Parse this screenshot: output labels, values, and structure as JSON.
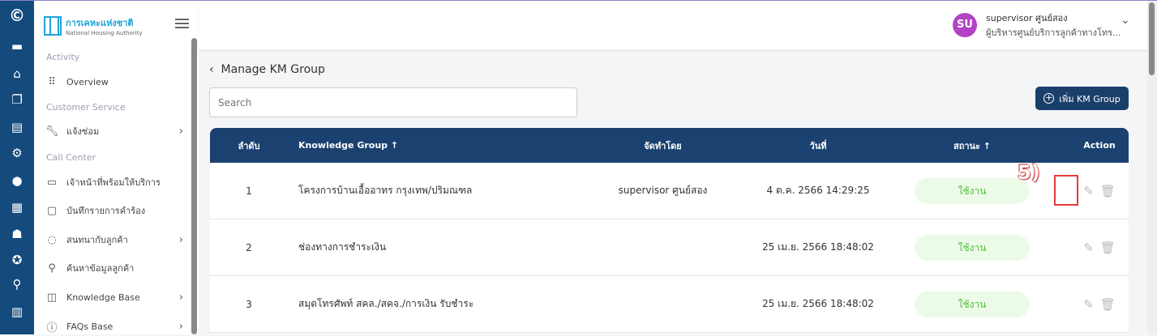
{
  "sidebar": {
    "logo_th": "การเคหะแห่งชาติ",
    "logo_en": "National Housing Authority",
    "sections": [
      "Activity",
      "Customer Service",
      "Call Center"
    ],
    "items": [
      {
        "label": "Overview"
      },
      {
        "label": "แจ้งซ่อม"
      },
      {
        "label": "เจ้าหน้าที่พร้อมให้บริการ"
      },
      {
        "label": "บันทึกรายการคำร้อง"
      },
      {
        "label": "สนทนากับลูกค้า"
      },
      {
        "label": "ค้นหาข้อมูลลูกค้า"
      },
      {
        "label": "Knowledge Base"
      },
      {
        "label": "FAQs Base"
      }
    ]
  },
  "header": {
    "avatar": "SU",
    "user_name": "supervisor ศูนย์สอง",
    "user_role": "ผู้บริหารศูนย์บริการลูกค้าทางโทร..."
  },
  "page": {
    "title": "Manage KM Group",
    "search_placeholder": "Search",
    "add_button": "เพิ่ม KM Group",
    "annotation": "5)"
  },
  "table": {
    "headers": [
      "ลำดับ",
      "Knowledge Group ↑",
      "จัดทำโดย",
      "วันที่",
      "สถานะ ↑",
      "Action"
    ],
    "rows": [
      {
        "no": "1",
        "group": "โครงการบ้านเอื้ออาทร กรุงเทพ/ปริมณฑล",
        "by": "supervisor ศูนย์สอง",
        "date": "4 ต.ค. 2566 14:29:25",
        "status": "ใช้งาน"
      },
      {
        "no": "2",
        "group": "ช่องทางการชำระเงิน",
        "by": "",
        "date": "25 เม.ย. 2566 18:48:02",
        "status": "ใช้งาน"
      },
      {
        "no": "3",
        "group": "สมุดโทรศัพท์ สคล./สคจ./การเงิน รับชำระ",
        "by": "",
        "date": "25 เม.ย. 2566 18:48:02",
        "status": "ใช้งาน"
      }
    ]
  }
}
